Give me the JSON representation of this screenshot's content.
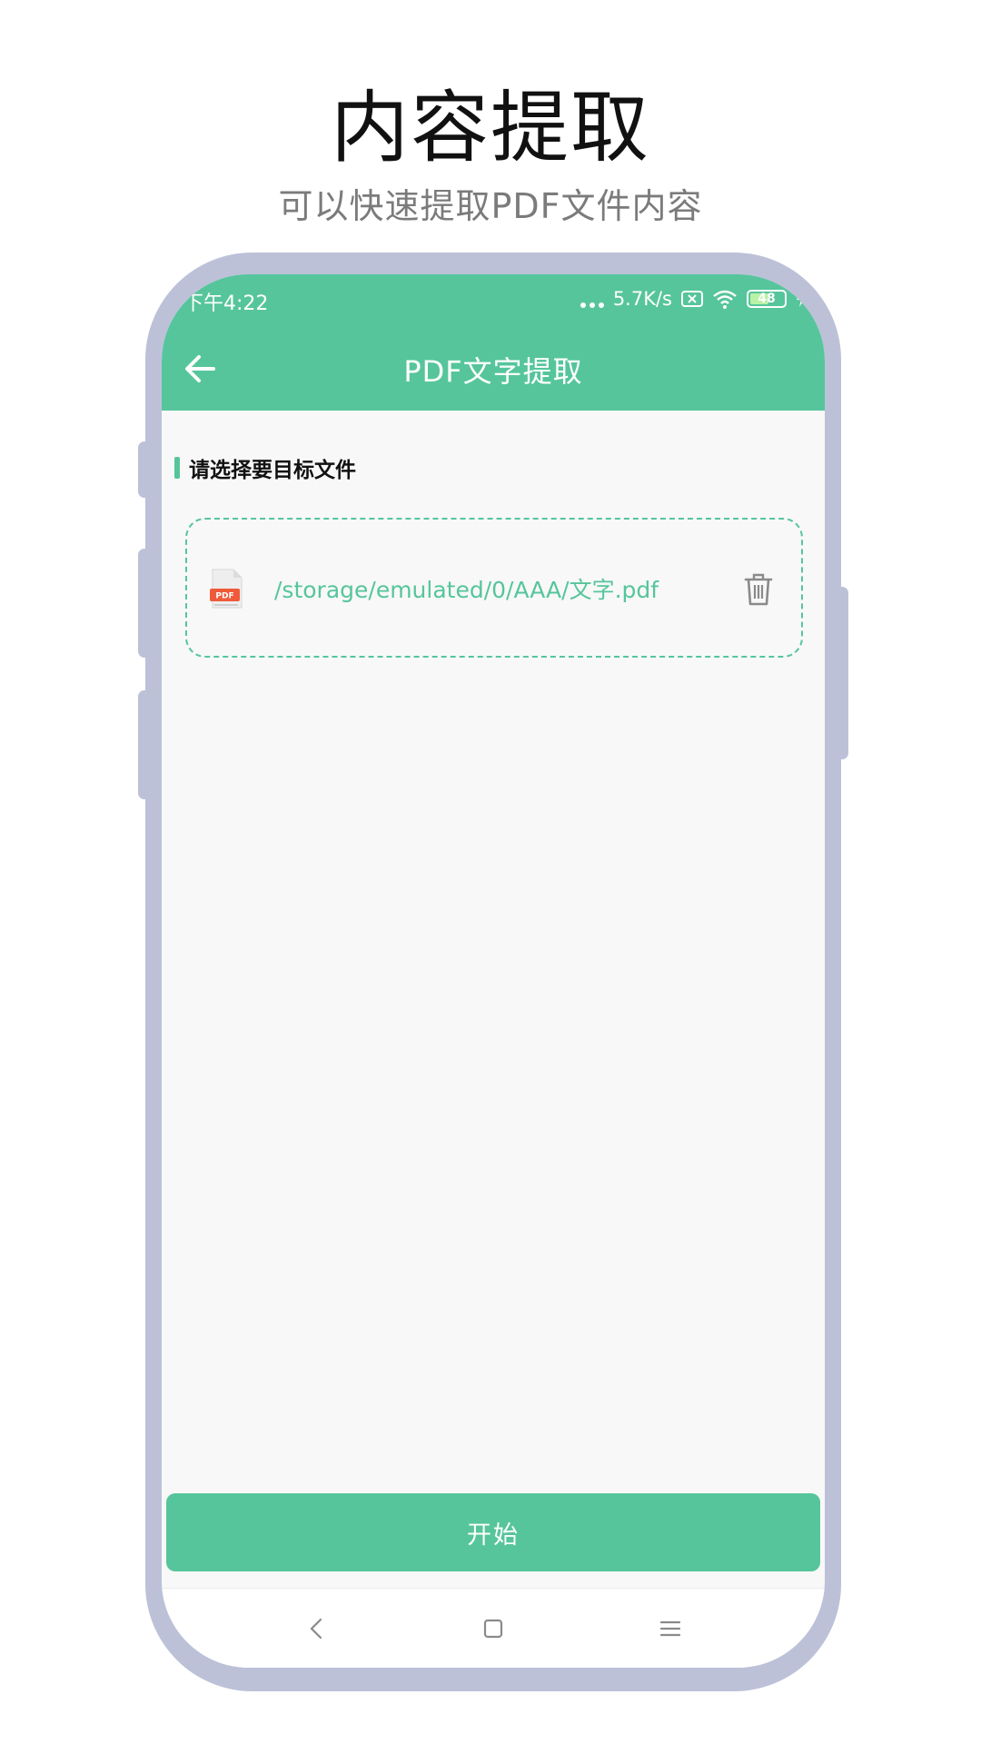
{
  "promo": {
    "title": "内容提取",
    "subtitle": "可以快速提取PDF文件内容"
  },
  "status_bar": {
    "time": "下午4:22",
    "network_speed": "5.7K/s",
    "battery_level": "48"
  },
  "app_bar": {
    "title": "PDF文字提取",
    "back_icon": "arrow-left-icon"
  },
  "section": {
    "label": "请选择要目标文件"
  },
  "file": {
    "path": "/storage/emulated/0/AAA/文字.pdf",
    "icon": "pdf-file-icon",
    "delete_icon": "trash-icon"
  },
  "actions": {
    "start_label": "开始"
  },
  "nav_bar": {
    "back_icon": "chevron-left-icon",
    "home_icon": "square-icon",
    "menu_icon": "hamburger-icon"
  },
  "colors": {
    "accent": "#56c59c",
    "frame": "#bcc1d8",
    "background": "#f8f8f8"
  }
}
